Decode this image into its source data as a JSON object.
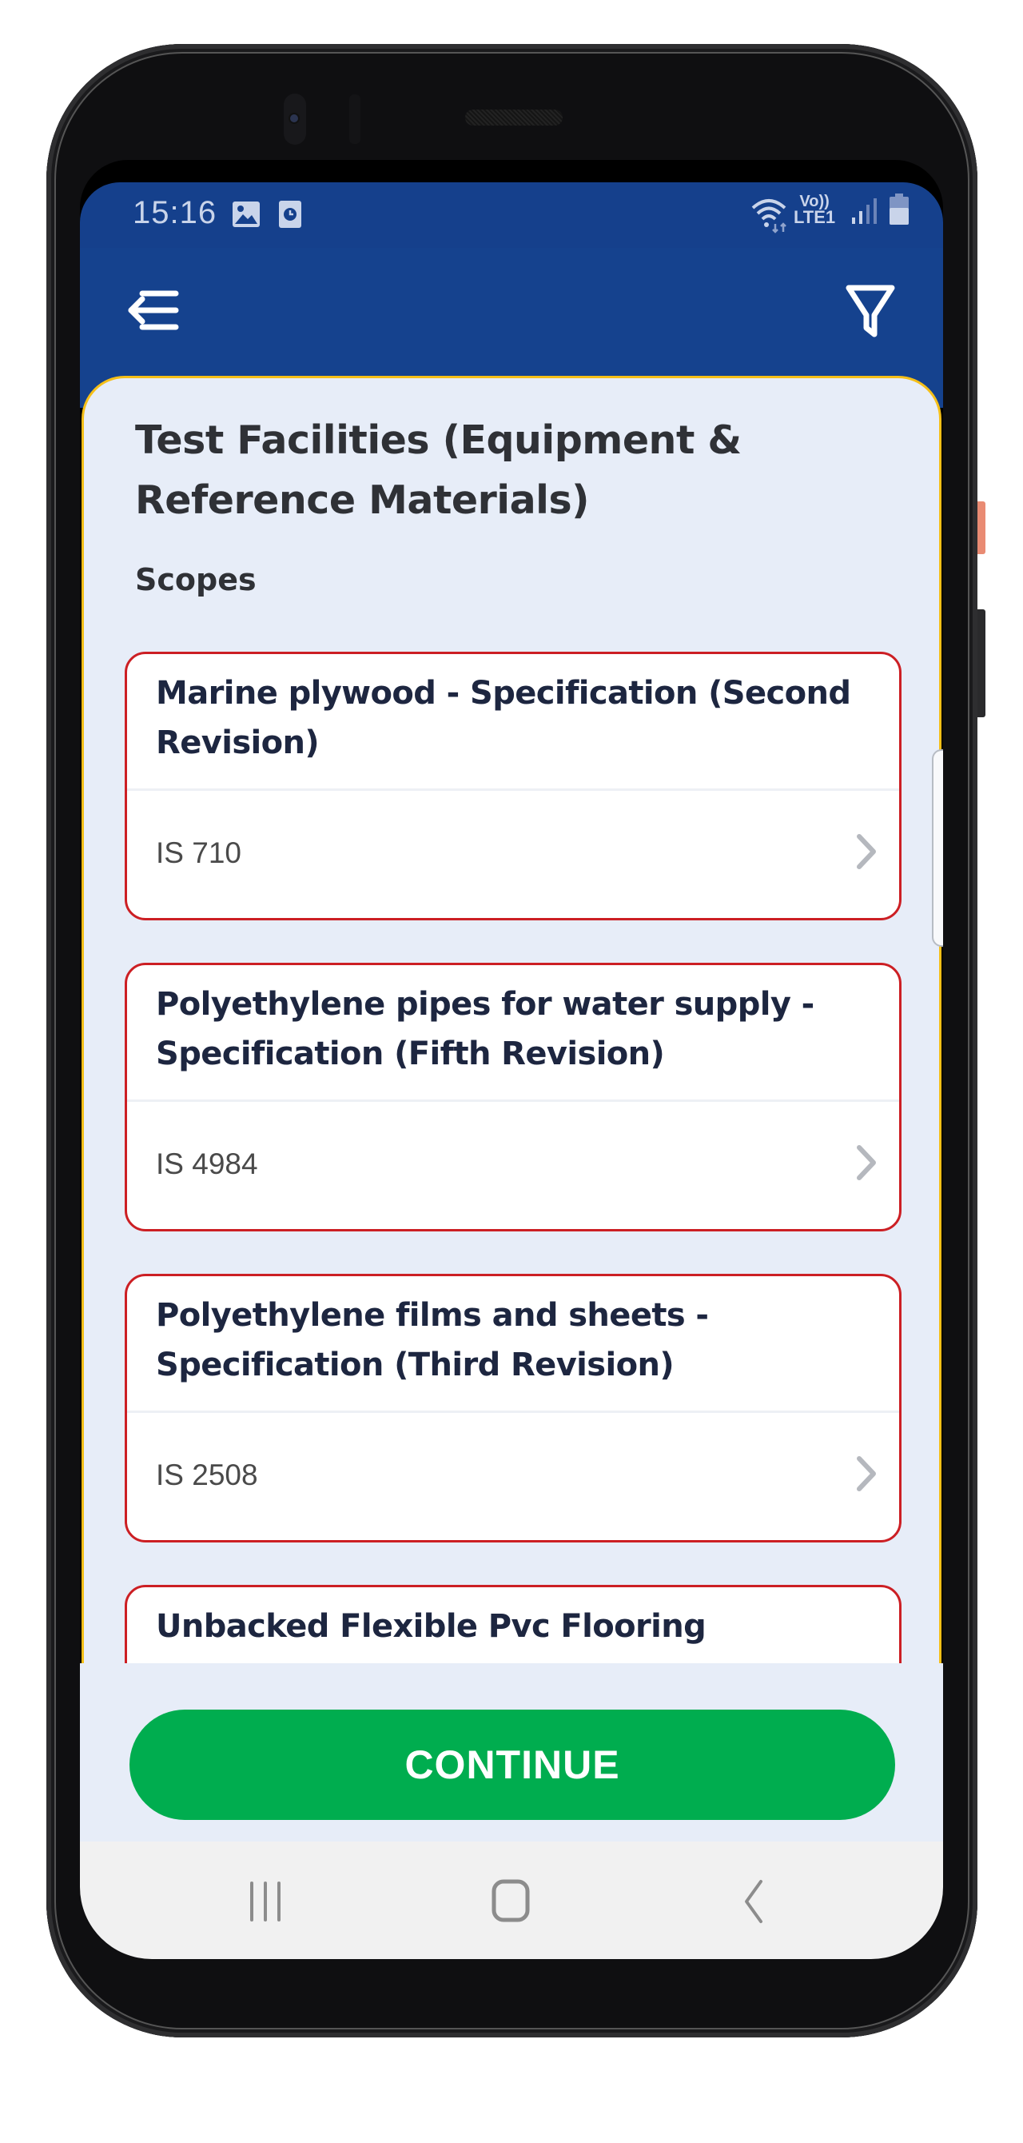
{
  "status_bar": {
    "time": "15:16",
    "left_icons": [
      "image-icon",
      "clock-notification-icon"
    ],
    "right_icons": [
      "wifi-icon",
      "volte-lte-icon",
      "signal-icon",
      "battery-icon"
    ],
    "volte_label_top": "Vo))",
    "volte_label_bottom": "LTE1"
  },
  "app_bar": {
    "menu_icon": "menu-back-arrow-icon",
    "filter_icon": "filter-funnel-icon",
    "background_color": "#15428e"
  },
  "panel": {
    "title": "Test Facilities (Equipment & Reference Materials)",
    "section_label": "Scopes",
    "border_color": "#f5bf18"
  },
  "scopes": [
    {
      "title": "Marine plywood - Specification (Second Revision)",
      "code": "IS 710"
    },
    {
      "title": "Polyethylene pipes for water supply - Specification (Fifth Revision)",
      "code": "IS 4984"
    },
    {
      "title": "Polyethylene films and sheets - Specification (Third Revision)",
      "code": "IS 2508"
    },
    {
      "title": "Unbacked Flexible Pvc Flooring",
      "code": ""
    }
  ],
  "card_border_color": "#cc1f24",
  "continue_button": {
    "label": "CONTINUE",
    "color": "#00ad4f"
  },
  "nav_bar": {
    "buttons": [
      "recent-apps",
      "home",
      "back"
    ]
  }
}
